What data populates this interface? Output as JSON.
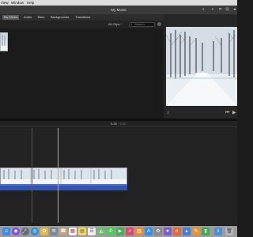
{
  "menubar": {
    "items": [
      "View",
      "Window",
      "Help"
    ]
  },
  "window": {
    "title": "My Movie"
  },
  "tabs": [
    {
      "label": "My Media"
    },
    {
      "label": "Audio"
    },
    {
      "label": "Titles"
    },
    {
      "label": "Backgrounds"
    },
    {
      "label": "Transitions"
    }
  ],
  "browser": {
    "filter_label": "All Clips ÷",
    "search_placeholder": "Search"
  },
  "timeline": {
    "current_time": "0:26",
    "total_time": "/ 1:00"
  },
  "toolbar_icons": [
    "color-balance-icon",
    "color-correction-icon",
    "crop-icon",
    "stabilization-icon",
    "volume-icon",
    "noise-reduction-icon",
    "speed-icon",
    "info-icon"
  ],
  "colors": {
    "accent_audio": "#2f55b5",
    "menubar": "#dcdcdc",
    "titlebar": "#3a3a3a"
  }
}
